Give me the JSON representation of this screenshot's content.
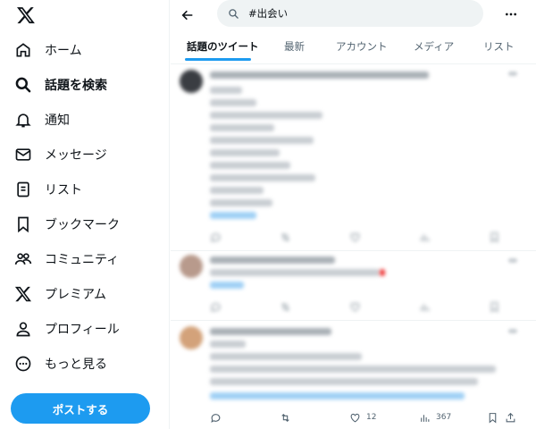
{
  "sidebar": {
    "items": [
      {
        "label": "ホーム",
        "icon": "home-icon"
      },
      {
        "label": "話題を検索",
        "icon": "search-icon",
        "active": true
      },
      {
        "label": "通知",
        "icon": "bell-icon"
      },
      {
        "label": "メッセージ",
        "icon": "mail-icon"
      },
      {
        "label": "リスト",
        "icon": "list-icon"
      },
      {
        "label": "ブックマーク",
        "icon": "bookmark-icon"
      },
      {
        "label": "コミュニティ",
        "icon": "community-icon"
      },
      {
        "label": "プレミアム",
        "icon": "x-logo-icon"
      },
      {
        "label": "プロフィール",
        "icon": "person-icon"
      },
      {
        "label": "もっと見る",
        "icon": "more-circle-icon"
      }
    ],
    "post_button": "ポストする"
  },
  "search": {
    "query": "#出会い"
  },
  "tabs": [
    {
      "label": "話題のツイート",
      "active": true
    },
    {
      "label": "最新"
    },
    {
      "label": "アカウント"
    },
    {
      "label": "メディア"
    },
    {
      "label": "リスト"
    }
  ],
  "tweets": [
    {
      "likes": "",
      "views": ""
    },
    {
      "likes": "",
      "views": ""
    },
    {
      "likes": "12",
      "views": "367"
    }
  ],
  "colors": {
    "accent": "#1d9bf0",
    "text": "#0f1419",
    "muted": "#536471",
    "border": "#eff3f4"
  }
}
